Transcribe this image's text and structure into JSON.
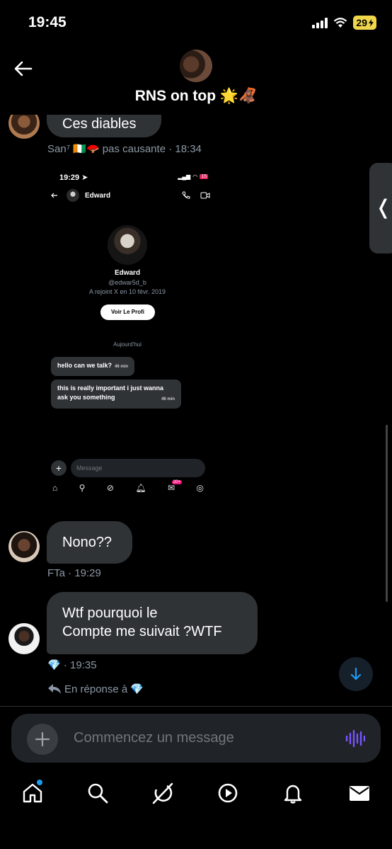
{
  "status_bar": {
    "time": "19:45",
    "battery": "29"
  },
  "header": {
    "title": "RNS on top 🌟🦧"
  },
  "messages": [
    {
      "text": "Ces diables",
      "meta": "San⁷ 🇨🇮🪭 pas causante · 18:34"
    },
    {
      "text": "Nono??",
      "meta": "FTa · 19:29"
    },
    {
      "text_line1": "Wtf pourquoi le",
      "text_line2": "Compte me suivait ?WTF",
      "meta": "💎 · 19:35",
      "reply": "En réponse à 💎"
    }
  ],
  "screenshot": {
    "time": "19:29",
    "battery": "15",
    "contact_name": "Edward",
    "profile_name": "Edward",
    "handle": "@edwar5d_b",
    "joined": "A rejoint X en 10 févr. 2019",
    "profile_button": "Voir Le Profi",
    "day": "Aujourd'hui",
    "bubble1": "hello can we talk?",
    "bubble1_time": "46 min",
    "bubble2_line1": "this is really important i just wanna",
    "bubble2_line2": "ask you something",
    "bubble2_time": "46 min",
    "placeholder": "Message",
    "badge": "20+"
  },
  "composer": {
    "placeholder": "Commencez un message"
  },
  "colors": {
    "accent": "#1d9bf0",
    "bubble": "#2f3336",
    "voice": "#7856ff"
  },
  "icons": {
    "bottom_nav": [
      "home-icon",
      "search-icon",
      "grok-icon",
      "video-icon",
      "bell-icon",
      "mail-icon"
    ]
  }
}
